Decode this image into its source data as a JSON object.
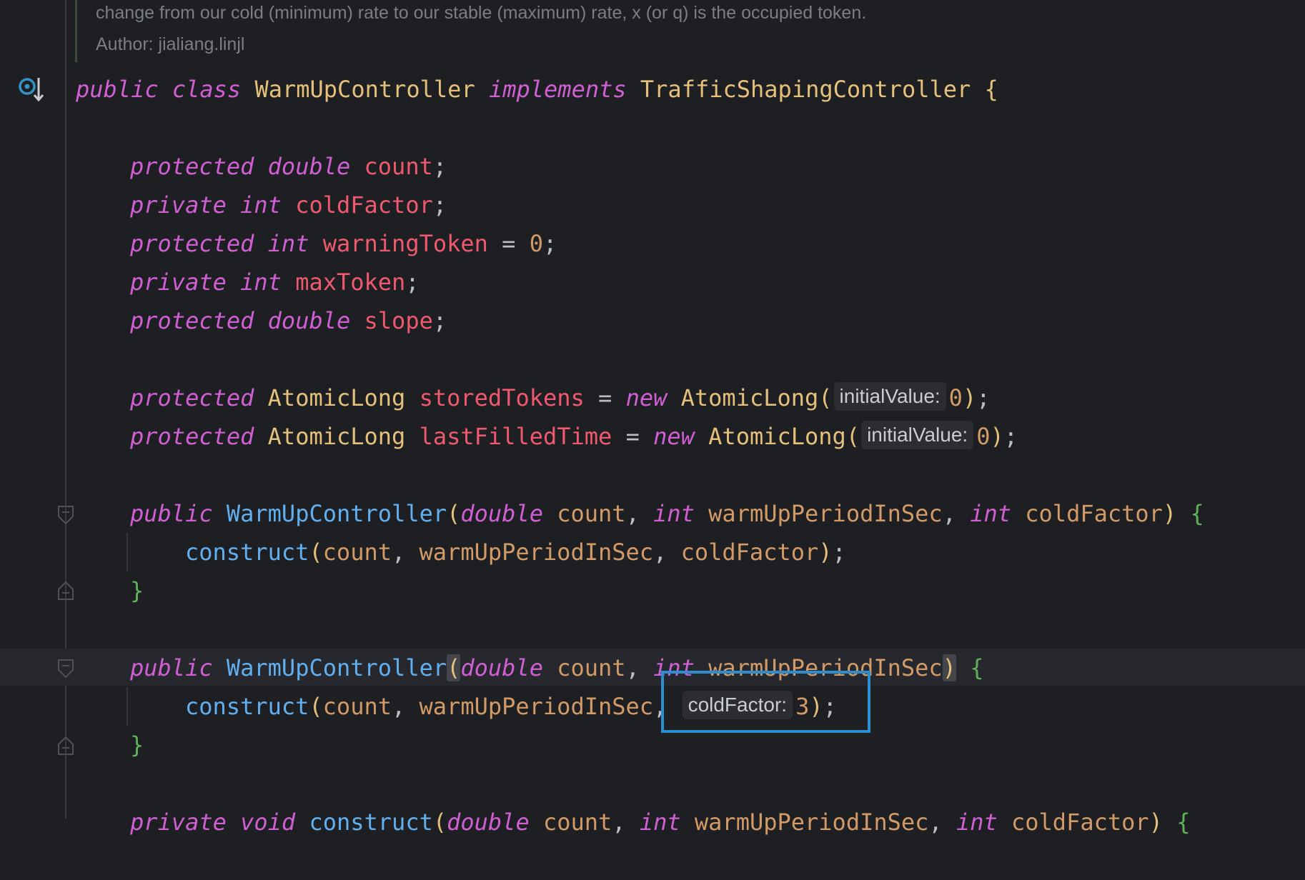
{
  "doc": {
    "line1": "change from our cold (minimum) rate to our stable (maximum) rate, x (or q) is the occupied token.",
    "author": "Author: jialiang.linjl"
  },
  "icons": {
    "implements": "implementing-interface-icon",
    "fold": "fold-icon"
  },
  "code": {
    "class_kw_public": "public",
    "class_kw_class": "class",
    "class_name": "WarmUpController",
    "class_kw_implements": "implements",
    "class_iface": "TrafficShapingController",
    "open_brace": "{",
    "f1_mod": "protected",
    "f1_type": "double",
    "f1_name": "count",
    "f2_mod": "private",
    "f2_type": "int",
    "f2_name": "coldFactor",
    "f3_mod": "protected",
    "f3_type": "int",
    "f3_name": "warningToken",
    "f3_value": "0",
    "f4_mod": "private",
    "f4_type": "int",
    "f4_name": "maxToken",
    "f5_mod": "protected",
    "f5_type": "double",
    "f5_name": "slope",
    "f6_mod": "protected",
    "f6_type": "AtomicLong",
    "f6_name": "storedTokens",
    "f6_new": "new",
    "f6_ctor": "AtomicLong(",
    "f6_hint": "initialValue:",
    "f6_value": "0",
    "f7_mod": "protected",
    "f7_type": "AtomicLong",
    "f7_name": "lastFilledTime",
    "f7_new": "new",
    "f7_ctor": "AtomicLong(",
    "f7_hint": "initialValue:",
    "f7_value": "0",
    "c1_public": "public",
    "c1_name": "WarmUpController",
    "c1_t1": "double",
    "c1_p1": "count",
    "c1_t2": "int",
    "c1_p2": "warmUpPeriodInSec",
    "c1_t3": "int",
    "c1_p3": "coldFactor",
    "c1_call": "construct",
    "c1_a1": "count",
    "c1_a2": "warmUpPeriodInSec",
    "c1_a3": "coldFactor",
    "c2_public": "public",
    "c2_name": "WarmUpController",
    "c2_t1": "double",
    "c2_p1": "count",
    "c2_t2": "int",
    "c2_p2": "warmUpPeriodInSec",
    "c2_call": "construct",
    "c2_a1": "count",
    "c2_a2": "warmUpPeriodInSec",
    "c2_hint": "coldFactor:",
    "c2_value": "3",
    "close_brace": "}",
    "m_private": "private",
    "m_void": "void",
    "m_name": "construct",
    "m_t1": "double",
    "m_p1": "count",
    "m_t2": "int",
    "m_p2": "warmUpPeriodInSec",
    "m_t3": "int",
    "m_p3": "coldFactor"
  }
}
